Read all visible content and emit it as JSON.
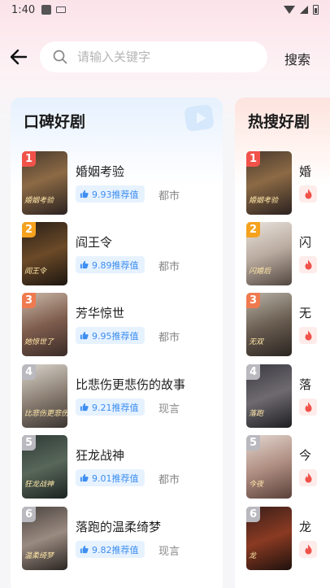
{
  "status_bar": {
    "time": "1:40"
  },
  "search": {
    "placeholder": "请输入关键字",
    "value": "",
    "button_label": "搜索"
  },
  "left_panel": {
    "title": "口碑好剧",
    "items": [
      {
        "rank": "1",
        "title": "婚姻考验",
        "score": "9.93推荐值",
        "genre": "都市",
        "poster_text": "婚姻考验"
      },
      {
        "rank": "2",
        "title": "阎王令",
        "score": "9.89推荐值",
        "genre": "都市",
        "poster_text": "阎王令"
      },
      {
        "rank": "3",
        "title": "芳华惊世",
        "score": "9.95推荐值",
        "genre": "都市",
        "poster_text": "她惊世了"
      },
      {
        "rank": "4",
        "title": "比悲伤更悲伤的故事",
        "score": "9.21推荐值",
        "genre": "现言",
        "poster_text": "比悲伤更悲伤"
      },
      {
        "rank": "5",
        "title": "狂龙战神",
        "score": "9.01推荐值",
        "genre": "都市",
        "poster_text": "狂龙战神"
      },
      {
        "rank": "6",
        "title": "落跑的温柔绮梦",
        "score": "9.82推荐值",
        "genre": "现言",
        "poster_text": "温柔绮梦"
      }
    ]
  },
  "right_panel": {
    "title": "热搜好剧",
    "items": [
      {
        "rank": "1",
        "title": "婚",
        "poster_text": "婚姻考验"
      },
      {
        "rank": "2",
        "title": "闪",
        "poster_text": "闪婚后"
      },
      {
        "rank": "3",
        "title": "无",
        "poster_text": "无双"
      },
      {
        "rank": "4",
        "title": "落",
        "poster_text": "落跑"
      },
      {
        "rank": "5",
        "title": "今",
        "poster_text": "今夜"
      },
      {
        "rank": "6",
        "title": "龙",
        "poster_text": "龙"
      }
    ]
  },
  "colors": {
    "rank_1": "#f0524a",
    "rank_2": "#f5a21f",
    "rank_3": "#f07a4f",
    "rank_other": "#b9b9bf",
    "score_text": "#3d8ef0",
    "fire": "#f0524a"
  },
  "icons": {
    "back": "arrow-left-icon",
    "search": "magnifier-icon",
    "score": "thumbs-up-icon",
    "hot": "fire-icon"
  }
}
